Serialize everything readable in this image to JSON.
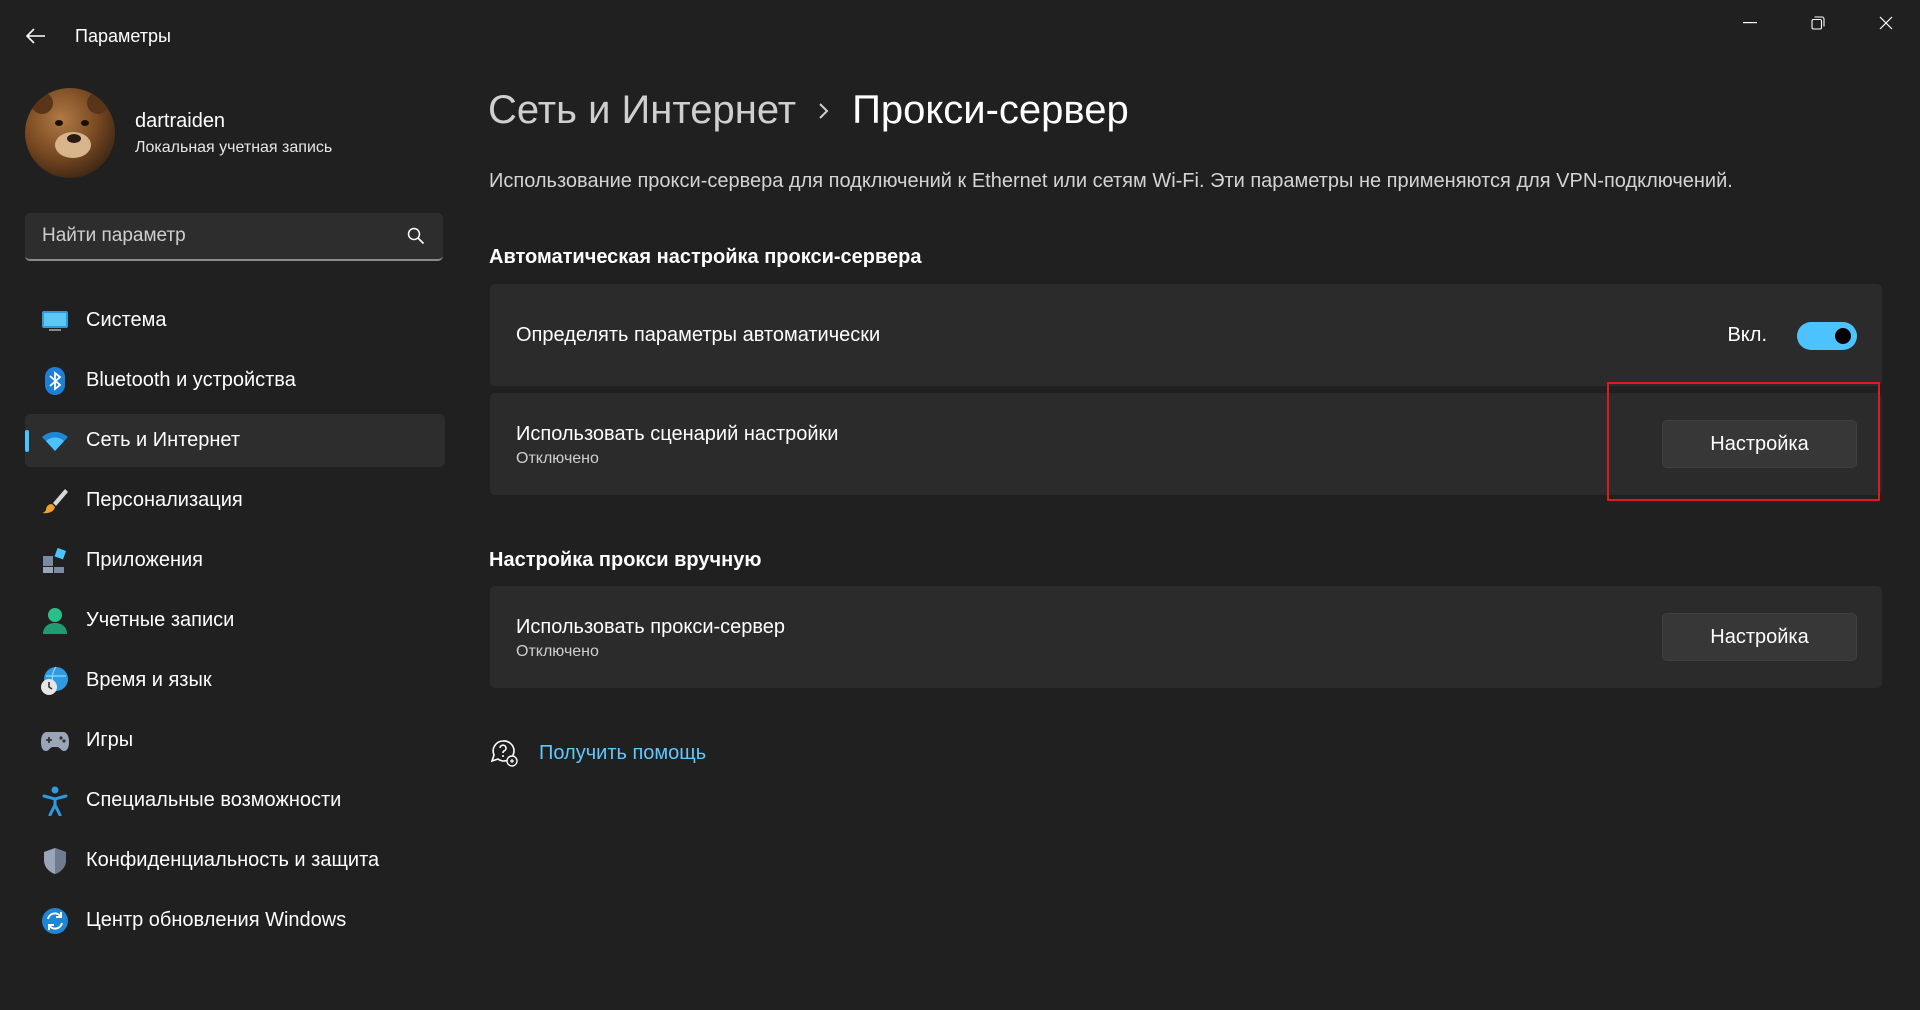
{
  "window": {
    "title": "Параметры",
    "back_icon": "arrow-left-icon",
    "controls": [
      "minimize-icon",
      "restore-icon",
      "close-icon"
    ]
  },
  "profile": {
    "name": "dartraiden",
    "account_type": "Локальная учетная запись"
  },
  "search": {
    "placeholder": "Найти параметр"
  },
  "sidebar": {
    "items": [
      {
        "label": "Система",
        "icon": "monitor-icon",
        "active": false
      },
      {
        "label": "Bluetooth и устройства",
        "icon": "bluetooth-icon",
        "active": false
      },
      {
        "label": "Сеть и Интернет",
        "icon": "wifi-icon",
        "active": true
      },
      {
        "label": "Персонализация",
        "icon": "brush-icon",
        "active": false
      },
      {
        "label": "Приложения",
        "icon": "apps-icon",
        "active": false
      },
      {
        "label": "Учетные записи",
        "icon": "person-icon",
        "active": false
      },
      {
        "label": "Время и язык",
        "icon": "globe-clock-icon",
        "active": false
      },
      {
        "label": "Игры",
        "icon": "gamepad-icon",
        "active": false
      },
      {
        "label": "Специальные возможности",
        "icon": "accessibility-icon",
        "active": false
      },
      {
        "label": "Конфиденциальность и защита",
        "icon": "shield-icon",
        "active": false
      },
      {
        "label": "Центр обновления Windows",
        "icon": "update-icon",
        "active": false
      }
    ]
  },
  "breadcrumb": {
    "parent": "Сеть и Интернет",
    "current": "Прокси-сервер"
  },
  "description": "Использование прокси-сервера для подключений к Ethernet или сетям Wi-Fi. Эти параметры не применяются для VPN-подключений.",
  "auto_section": {
    "title": "Автоматическая настройка прокси-сервера",
    "detect": {
      "label": "Определять параметры автоматически",
      "state": "Вкл.",
      "on": true
    },
    "script": {
      "label": "Использовать сценарий настройки",
      "status": "Отключено",
      "button": "Настройка"
    }
  },
  "manual_section": {
    "title": "Настройка прокси вручную",
    "proxy": {
      "label": "Использовать прокси-сервер",
      "status": "Отключено",
      "button": "Настройка"
    }
  },
  "help": {
    "label": "Получить помощь"
  },
  "colors": {
    "background": "#202020",
    "card": "#2b2b2b",
    "accent": "#4cc2ff",
    "highlight": "#e0191e",
    "link": "#5fc8ff"
  }
}
